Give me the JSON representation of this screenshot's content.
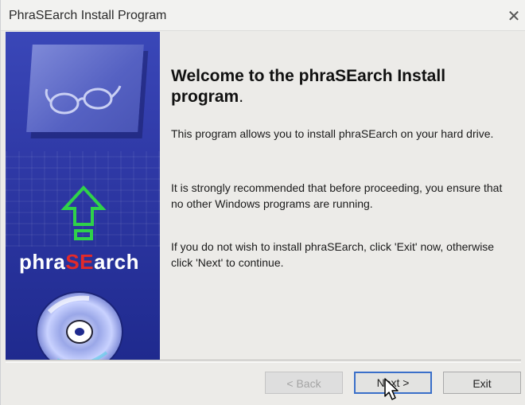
{
  "window": {
    "title": "PhraSEarch Install Program",
    "close_symbol": "✕"
  },
  "sidebar": {
    "logo_prefix": "phra",
    "logo_highlight": "SE",
    "logo_suffix": "arch",
    "icons": [
      "glasses-icon",
      "up-arrow-icon",
      "cd-disc-icon"
    ],
    "colors": {
      "background": "#2f39a6",
      "arrow": "#2fd24a",
      "highlight": "#e32a2a"
    }
  },
  "content": {
    "heading_line1": "Welcome to the phraSEarch Install",
    "heading_line2": "program",
    "heading_period": ".",
    "para1": "This program allows you to install phraSEarch on your hard drive.",
    "para2": "It is strongly recommended that before proceeding, you ensure that no other Windows programs are running.",
    "para3": "If you do not wish to install phraSEarch, click 'Exit' now, otherwise click 'Next' to continue."
  },
  "buttons": {
    "back": "< Back",
    "next": "Next >",
    "exit": "Exit"
  }
}
